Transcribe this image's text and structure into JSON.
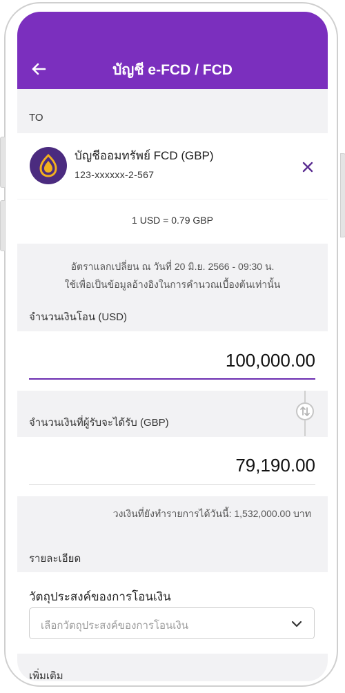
{
  "header": {
    "title": "บัญชี e-FCD / FCD"
  },
  "to": {
    "section_label": "TO",
    "account_name": "บัญชีออมทรัพย์ FCD (GBP)",
    "account_number": "123-xxxxxx-2-567"
  },
  "exchange": {
    "rate_text": "1 USD = 0.79 GBP",
    "note_line1": "อัตราแลกเปลี่ยน ณ วันที่ 20 มิ.ย. 2566 - 09:30 น.",
    "note_line2": "ใช้เพื่อเป็นข้อมูลอ้างอิงในการคำนวณเบื้องต้นเท่านั้น"
  },
  "transfer": {
    "amount_label": "จำนวนเงินโอน (USD)",
    "amount_value": "100,000.00",
    "receive_label": "จำนวนเงินที่ผู้รับจะได้รับ (GBP)",
    "receive_value": "79,190.00",
    "limit_text": "วงเงินที่ยังทำรายการได้วันนี้: 1,532,000.00 บาท"
  },
  "details": {
    "section_label": "รายละเอียด",
    "purpose_label": "วัตถุประสงค์ของการโอนเงิน",
    "purpose_placeholder": "เลือกวัตถุประสงค์ของการโอนเงิน",
    "more_label": "เพิ่มเติม"
  },
  "colors": {
    "brand": "#7b2fbe",
    "accent_icon": "#5a2d91",
    "logo_bg": "#4b2b7f",
    "logo_mark": "#f2b01e"
  },
  "icons": [
    "back-arrow-icon",
    "bank-logo-icon",
    "close-icon",
    "swap-icon",
    "chevron-down-icon"
  ]
}
